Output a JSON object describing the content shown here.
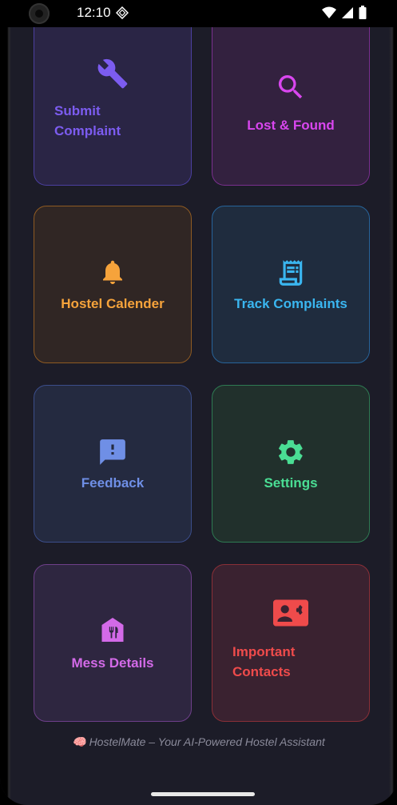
{
  "status_bar": {
    "time": "12:10"
  },
  "cards": [
    {
      "label": "Submit\nComplaint",
      "icon": "wrench-icon",
      "color": "#7c5cf0"
    },
    {
      "label": "Lost & Found",
      "icon": "search-icon",
      "color": "#d946ef"
    },
    {
      "label": "Hostel Calender",
      "icon": "bell-icon",
      "color": "#f6a33b"
    },
    {
      "label": "Track Complaints",
      "icon": "receipt-icon",
      "color": "#3ab6f0"
    },
    {
      "label": "Feedback",
      "icon": "feedback-icon",
      "color": "#6f8fe6"
    },
    {
      "label": "Settings",
      "icon": "gear-icon",
      "color": "#4ade94"
    },
    {
      "label": "Mess Details",
      "icon": "mess-icon",
      "color": "#d36ae8"
    },
    {
      "label": "Important\nContacts",
      "icon": "contact-card-icon",
      "color": "#ef4b4b"
    }
  ],
  "footer": {
    "text": "🧠 HostelMate – Your AI-Powered Hostel Assistant"
  }
}
